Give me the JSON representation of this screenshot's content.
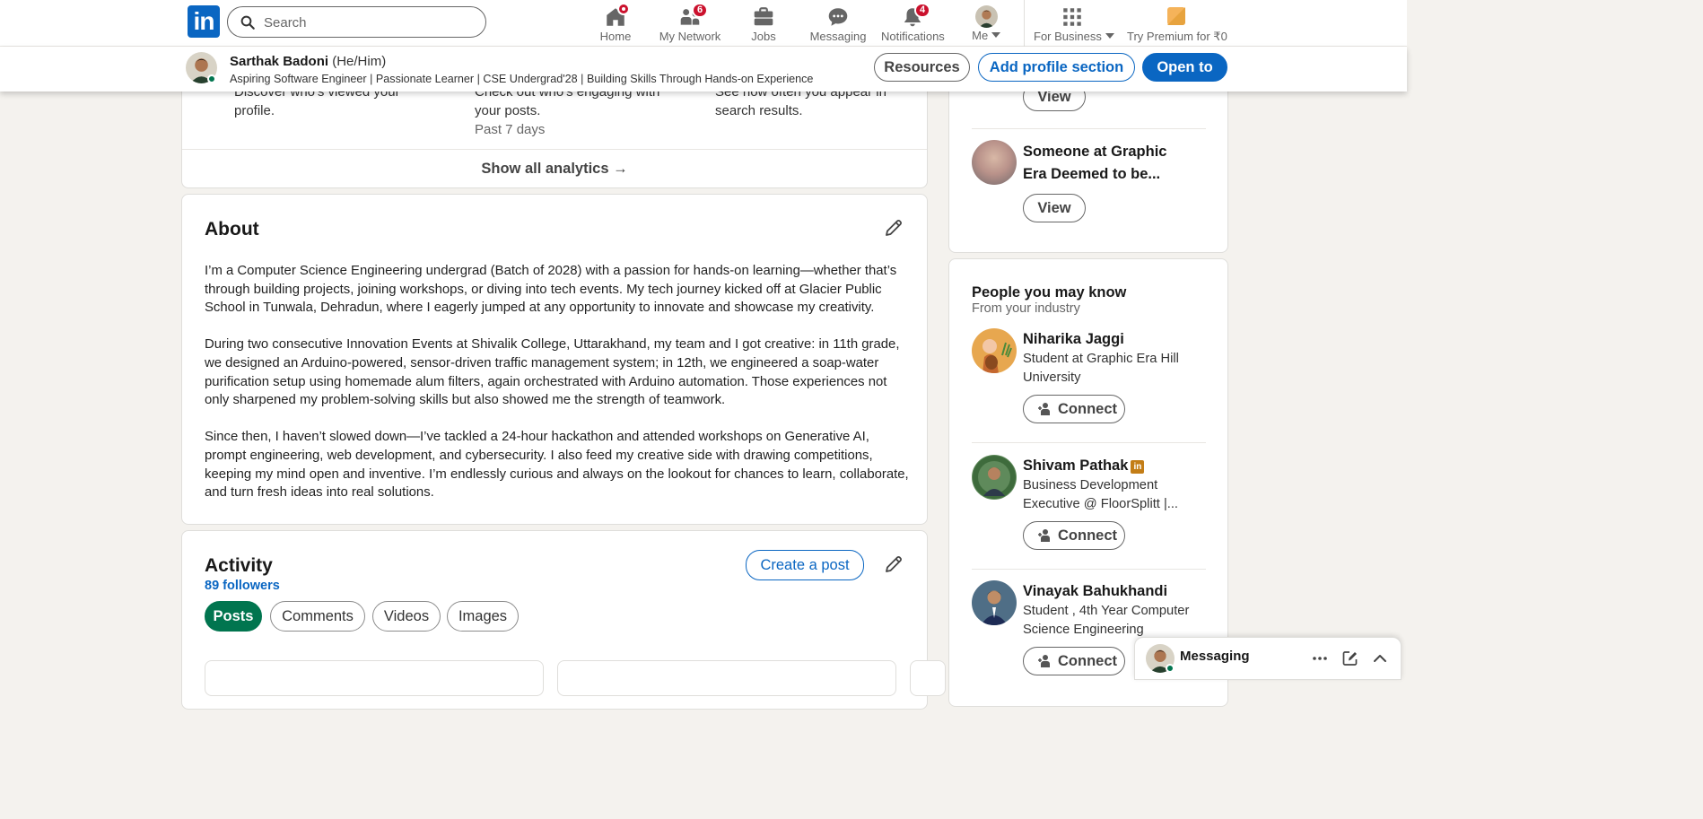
{
  "nav": {
    "search_placeholder": "Search",
    "items": [
      {
        "label": "Home",
        "icon": "home-icon",
        "badge": ""
      },
      {
        "label": "My Network",
        "icon": "people-icon",
        "badge": "6"
      },
      {
        "label": "Jobs",
        "icon": "briefcase-icon",
        "badge": ""
      },
      {
        "label": "Messaging",
        "icon": "chat-icon",
        "badge": ""
      },
      {
        "label": "Notifications",
        "icon": "bell-icon",
        "badge": "4"
      },
      {
        "label": "Me",
        "icon": "avatar",
        "badge": ""
      },
      {
        "label": "For Business",
        "icon": "grid-icon",
        "badge": ""
      },
      {
        "label": "Try Premium for ₹0",
        "icon": "premium-icon",
        "badge": ""
      }
    ]
  },
  "profile": {
    "name": "Sarthak Badoni",
    "pronouns": "(He/Him)",
    "headline": "Aspiring Software Engineer | Passionate Learner | CSE Undergrad'28 | Building Skills Through Hands-on Experience",
    "buttons": {
      "resources": "Resources",
      "add_section": "Add profile section",
      "open_to": "Open to"
    }
  },
  "analytics": {
    "items": [
      {
        "text": "Discover who's viewed your profile.",
        "sub": ""
      },
      {
        "text": "Check out who's engaging with your posts.",
        "sub": "Past 7 days"
      },
      {
        "text": "See how often you appear in search results.",
        "sub": ""
      }
    ],
    "show_all": "Show all analytics →"
  },
  "about": {
    "title": "About",
    "paragraphs": [
      "I’m a Computer Science Engineering undergrad (Batch of 2028) with a passion for hands-on learning—whether that’s through building projects, joining workshops, or diving into tech events. My tech journey kicked off at Glacier Public School in Tunwala, Dehradun, where I eagerly jumped at any opportunity to innovate and showcase my creativity.",
      "During two consecutive Innovation Events at Shivalik College, Uttarakhand, my team and I got creative: in 11th grade, we designed an Arduino-powered, sensor-driven traffic management system; in 12th, we engineered a soap-water purification setup using homemade alum filters, again orchestrated with Arduino automation. Those experiences not only sharpened my problem-solving skills but also showed me the strength of teamwork.",
      "Since then, I haven’t slowed down—I’ve tackled a 24-hour hackathon and attended workshops on Generative AI, prompt engineering, web development, and cybersecurity. I also feed my creative side with drawing competitions, keeping my mind open and inventive. I’m endlessly curious and always on the lookout for chances to learn, collaborate, and turn fresh ideas into real solutions."
    ]
  },
  "activity": {
    "title": "Activity",
    "followers": "89 followers",
    "create_post": "Create a post",
    "tabs": [
      "Posts",
      "Comments",
      "Videos",
      "Images"
    ],
    "active_tab": "Posts"
  },
  "viewers": {
    "items": [
      {
        "name": "Someone at Graphic Era Deemed to be...",
        "button": "View"
      }
    ],
    "top_button": "View"
  },
  "pymk": {
    "title": "People you may know",
    "subtitle": "From your industry",
    "people": [
      {
        "name": "Niharika Jaggi",
        "subtitle": "Student at Graphic Era Hill University",
        "button": "Connect",
        "li_badge": false
      },
      {
        "name": "Shivam Pathak",
        "subtitle": "Business Development Executive @ FloorSplitt |...",
        "button": "Connect",
        "li_badge": true
      },
      {
        "name": "Vinayak Bahukhandi",
        "subtitle": "Student , 4th Year Computer Science Engineering",
        "button": "Connect",
        "li_badge": false
      }
    ]
  },
  "messaging": {
    "label": "Messaging"
  },
  "colors": {
    "brand": "#0a66c2",
    "green": "#01754f",
    "badge": "#cb112d",
    "background": "#f4f2ee"
  }
}
